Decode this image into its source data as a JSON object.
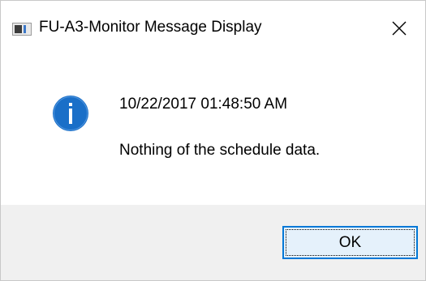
{
  "window": {
    "title": "FU-A3-Monitor Message Display",
    "close_icon": "close-icon"
  },
  "message": {
    "icon": "info-icon",
    "timestamp": "10/22/2017 01:48:50 AM",
    "text": "Nothing of the schedule data."
  },
  "buttons": {
    "ok_label": "OK"
  },
  "colors": {
    "info_icon_fill": "#1a6fc8",
    "footer_background": "#f0f0f0",
    "button_border": "#0078d7",
    "button_background": "#e5f1fb"
  }
}
